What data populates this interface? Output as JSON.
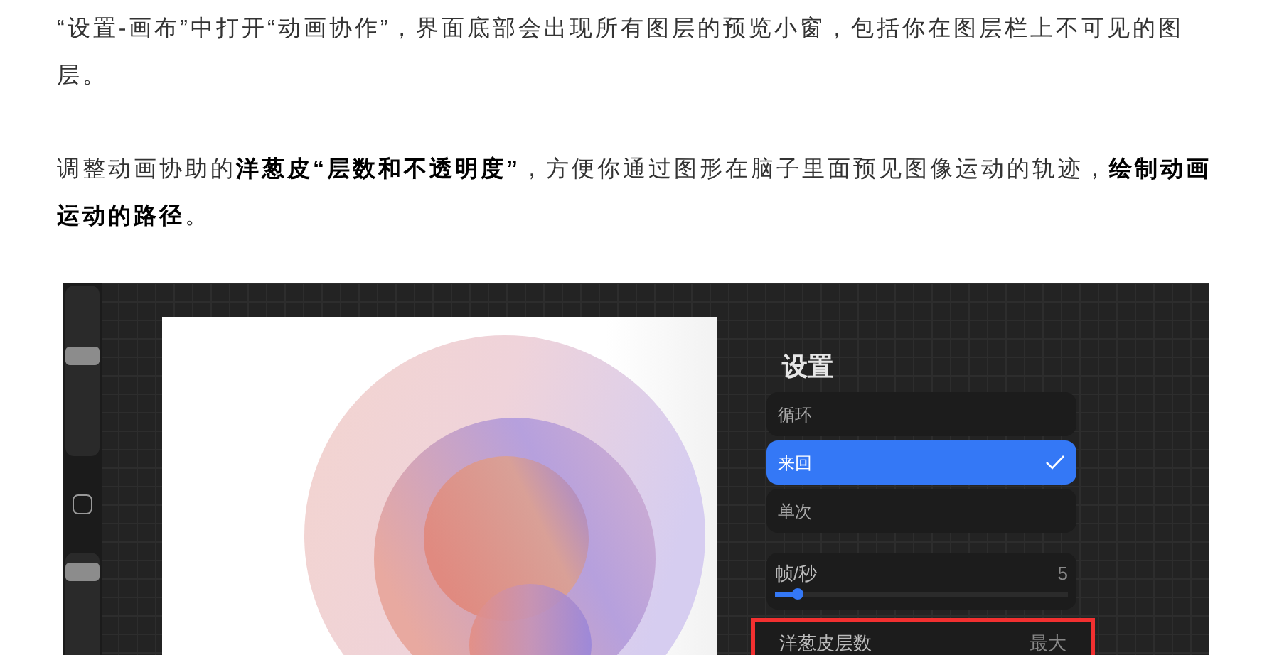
{
  "article": {
    "paragraphs": [
      "“设置-画布”中打开“动画协作”，界面底部会出现所有图层的预览小窗，包括你在图层栏上不可见的图层。",
      "调整动画协助的**洋葱皮“层数和不透明度”**，方便你通过图形在脑子里面预见图像运动的轨迹，**绘制动画运动的路径**。"
    ]
  },
  "screenshot": {
    "sidebar": {
      "sliders": [
        {
          "level": 0.6
        },
        {
          "level": 0.93
        }
      ]
    },
    "settings": {
      "title": "设置",
      "playback_options": [
        {
          "label": "循环",
          "selected": false
        },
        {
          "label": "来回",
          "selected": true
        },
        {
          "label": "单次",
          "selected": false
        }
      ],
      "frame_rate": {
        "label": "帧/秒",
        "value": "5",
        "level": 0.08
      },
      "onion_skin_frames": {
        "label": "洋葱皮层数",
        "value": "最大",
        "highlighted": true
      }
    }
  }
}
